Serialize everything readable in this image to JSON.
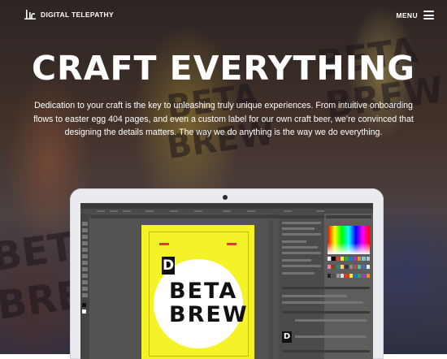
{
  "brand": {
    "name": "DIGITAL TELEPATHY"
  },
  "nav": {
    "menu_label": "MENU"
  },
  "hero": {
    "title": "CRAFT EVERYTHING",
    "intro": "Dedication to your craft is the key to unleashing truly unique experiences. From intuitive onboarding flows to easter egg 404 pages, and even a custom label for our own craft beer, we’re convinced that designing the details matters. The way we do anything is the way we do everything."
  },
  "background": {
    "can_text": [
      "BETA",
      "BREW",
      "BETA",
      "BETA",
      "BREW",
      "BREW"
    ]
  },
  "laptop": {
    "app": "Illustrator",
    "artwork": {
      "initial": "D",
      "line1": "BETA",
      "line2": "BREW"
    },
    "colors": {
      "artboard": "#f6f228",
      "accent_red": "#e8362c",
      "ink": "#111111"
    }
  },
  "icons": [
    "logo-icon",
    "hamburger-menu-icon",
    "laptop-camera-icon"
  ]
}
